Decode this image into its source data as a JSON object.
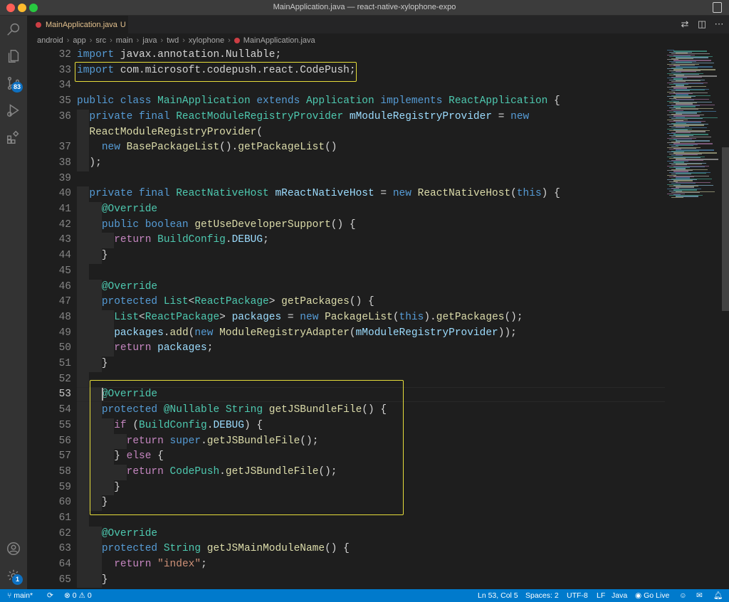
{
  "window": {
    "title": "MainApplication.java — react-native-xylophone-expo"
  },
  "activity_bar": {
    "source_control_badge": "83",
    "settings_badge": "1"
  },
  "tab": {
    "label": "MainApplication.java",
    "status": "U"
  },
  "breadcrumb": [
    "android",
    "app",
    "src",
    "main",
    "java",
    "twd",
    "xylophone",
    "MainApplication.java"
  ],
  "editor": {
    "line_numbers": [
      "32",
      "33",
      "34",
      "35",
      "36",
      "",
      "37",
      "38",
      "39",
      "40",
      "41",
      "42",
      "43",
      "44",
      "45",
      "46",
      "47",
      "48",
      "49",
      "50",
      "51",
      "52",
      "53",
      "54",
      "55",
      "56",
      "57",
      "58",
      "59",
      "60",
      "61",
      "62",
      "63",
      "64",
      "65"
    ],
    "active_line": "53",
    "lines": [
      [
        [
          "kw",
          "import"
        ],
        [
          "plain",
          " javax.annotation.Nullable;"
        ]
      ],
      [
        [
          "kw",
          "import"
        ],
        [
          "plain",
          " com.microsoft.codepush.react.CodePush;"
        ]
      ],
      [],
      [
        [
          "kw",
          "public class "
        ],
        [
          "ty",
          "MainApplication"
        ],
        [
          "kw",
          " extends "
        ],
        [
          "ty",
          "Application"
        ],
        [
          "kw",
          " implements "
        ],
        [
          "ty",
          "ReactApplication"
        ],
        [
          "plain",
          " {"
        ]
      ],
      [
        [
          "plain",
          "  "
        ],
        [
          "kw",
          "private final "
        ],
        [
          "ty",
          "ReactModuleRegistryProvider"
        ],
        [
          "plain",
          " "
        ],
        [
          "var",
          "mModuleRegistryProvider"
        ],
        [
          "plain",
          " = "
        ],
        [
          "kw",
          "new"
        ]
      ],
      [
        [
          "plain",
          "  "
        ],
        [
          "fn",
          "ReactModuleRegistryProvider"
        ],
        [
          "plain",
          "("
        ]
      ],
      [
        [
          "plain",
          "    "
        ],
        [
          "kw",
          "new "
        ],
        [
          "fn",
          "BasePackageList"
        ],
        [
          "plain",
          "()."
        ],
        [
          "fn",
          "getPackageList"
        ],
        [
          "plain",
          "()"
        ]
      ],
      [
        [
          "plain",
          "  );"
        ]
      ],
      [],
      [
        [
          "plain",
          "  "
        ],
        [
          "kw",
          "private final "
        ],
        [
          "ty",
          "ReactNativeHost"
        ],
        [
          "plain",
          " "
        ],
        [
          "var",
          "mReactNativeHost"
        ],
        [
          "plain",
          " = "
        ],
        [
          "kw",
          "new "
        ],
        [
          "fn",
          "ReactNativeHost"
        ],
        [
          "plain",
          "("
        ],
        [
          "kw",
          "this"
        ],
        [
          "plain",
          ") {"
        ]
      ],
      [
        [
          "plain",
          "    "
        ],
        [
          "ann",
          "@Override"
        ]
      ],
      [
        [
          "plain",
          "    "
        ],
        [
          "kw",
          "public boolean "
        ],
        [
          "fn",
          "getUseDeveloperSupport"
        ],
        [
          "plain",
          "() {"
        ]
      ],
      [
        [
          "plain",
          "      "
        ],
        [
          "ctl",
          "return "
        ],
        [
          "ty",
          "BuildConfig"
        ],
        [
          "plain",
          "."
        ],
        [
          "var",
          "DEBUG"
        ],
        [
          "plain",
          ";"
        ]
      ],
      [
        [
          "plain",
          "    }"
        ]
      ],
      [],
      [
        [
          "plain",
          "    "
        ],
        [
          "ann",
          "@Override"
        ]
      ],
      [
        [
          "plain",
          "    "
        ],
        [
          "kw",
          "protected "
        ],
        [
          "ty",
          "List"
        ],
        [
          "plain",
          "<"
        ],
        [
          "ty",
          "ReactPackage"
        ],
        [
          "plain",
          "> "
        ],
        [
          "fn",
          "getPackages"
        ],
        [
          "plain",
          "() {"
        ]
      ],
      [
        [
          "plain",
          "      "
        ],
        [
          "ty",
          "List"
        ],
        [
          "plain",
          "<"
        ],
        [
          "ty",
          "ReactPackage"
        ],
        [
          "plain",
          "> "
        ],
        [
          "var",
          "packages"
        ],
        [
          "plain",
          " = "
        ],
        [
          "kw",
          "new "
        ],
        [
          "fn",
          "PackageList"
        ],
        [
          "plain",
          "("
        ],
        [
          "kw",
          "this"
        ],
        [
          "plain",
          ")."
        ],
        [
          "fn",
          "getPackages"
        ],
        [
          "plain",
          "();"
        ]
      ],
      [
        [
          "plain",
          "      "
        ],
        [
          "var",
          "packages"
        ],
        [
          "plain",
          "."
        ],
        [
          "fn",
          "add"
        ],
        [
          "plain",
          "("
        ],
        [
          "kw",
          "new "
        ],
        [
          "fn",
          "ModuleRegistryAdapter"
        ],
        [
          "plain",
          "("
        ],
        [
          "var",
          "mModuleRegistryProvider"
        ],
        [
          "plain",
          "));"
        ]
      ],
      [
        [
          "plain",
          "      "
        ],
        [
          "ctl",
          "return "
        ],
        [
          "var",
          "packages"
        ],
        [
          "plain",
          ";"
        ]
      ],
      [
        [
          "plain",
          "    }"
        ]
      ],
      [],
      [
        [
          "plain",
          "    "
        ],
        [
          "ann",
          "@Override"
        ]
      ],
      [
        [
          "plain",
          "    "
        ],
        [
          "kw",
          "protected "
        ],
        [
          "ann",
          "@Nullable "
        ],
        [
          "ty",
          "String"
        ],
        [
          "plain",
          " "
        ],
        [
          "fn",
          "getJSBundleFile"
        ],
        [
          "plain",
          "() {"
        ]
      ],
      [
        [
          "plain",
          "      "
        ],
        [
          "ctl",
          "if"
        ],
        [
          "plain",
          " ("
        ],
        [
          "ty",
          "BuildConfig"
        ],
        [
          "plain",
          "."
        ],
        [
          "var",
          "DEBUG"
        ],
        [
          "plain",
          ") {"
        ]
      ],
      [
        [
          "plain",
          "        "
        ],
        [
          "ctl",
          "return "
        ],
        [
          "kw",
          "super"
        ],
        [
          "plain",
          "."
        ],
        [
          "fn",
          "getJSBundleFile"
        ],
        [
          "plain",
          "();"
        ]
      ],
      [
        [
          "plain",
          "      } "
        ],
        [
          "ctl",
          "else"
        ],
        [
          "plain",
          " {"
        ]
      ],
      [
        [
          "plain",
          "        "
        ],
        [
          "ctl",
          "return "
        ],
        [
          "ty",
          "CodePush"
        ],
        [
          "plain",
          "."
        ],
        [
          "fn",
          "getJSBundleFile"
        ],
        [
          "plain",
          "();"
        ]
      ],
      [
        [
          "plain",
          "      }"
        ]
      ],
      [
        [
          "plain",
          "    }"
        ]
      ],
      [],
      [
        [
          "plain",
          "    "
        ],
        [
          "ann",
          "@Override"
        ]
      ],
      [
        [
          "plain",
          "    "
        ],
        [
          "kw",
          "protected "
        ],
        [
          "ty",
          "String"
        ],
        [
          "plain",
          " "
        ],
        [
          "fn",
          "getJSMainModuleName"
        ],
        [
          "plain",
          "() {"
        ]
      ],
      [
        [
          "plain",
          "      "
        ],
        [
          "ctl",
          "return "
        ],
        [
          "str",
          "\"index\""
        ],
        [
          "plain",
          ";"
        ]
      ],
      [
        [
          "plain",
          "    }"
        ]
      ]
    ]
  },
  "status_bar": {
    "branch": "main*",
    "errors": "0",
    "warnings": "0",
    "cursor": "Ln 53, Col 5",
    "spaces": "Spaces: 2",
    "encoding": "UTF-8",
    "eol": "LF",
    "language": "Java",
    "live": "Go Live"
  },
  "theme": {
    "accent": "#007acc",
    "highlight_box": "#e6dd3b"
  }
}
